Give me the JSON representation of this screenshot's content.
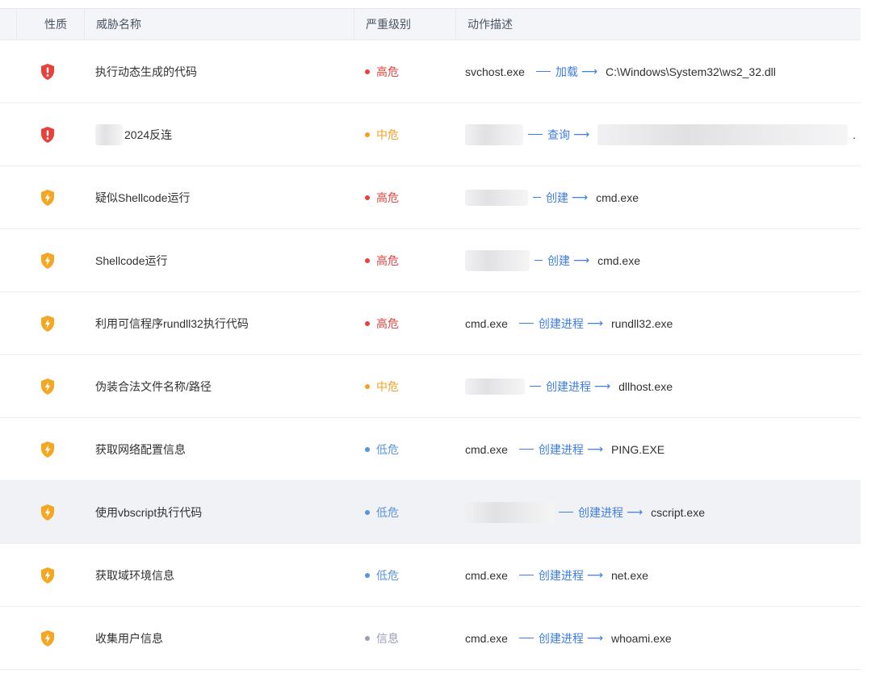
{
  "header": {
    "nature": "性质",
    "name": "威胁名称",
    "level": "严重级别",
    "action": "动作描述"
  },
  "colors": {
    "high": "#e8403a",
    "medium": "#f3a024",
    "low": "#5a93e0",
    "info": "#9a9eb5",
    "shield_red": "#e8403a",
    "shield_orange": "#f5a623",
    "link": "#3d7ee9"
  },
  "rows": [
    {
      "icon": "shield-alert-icon",
      "name": "执行动态生成的代码",
      "level": "高危",
      "level_key": "high",
      "src": "svchost.exe",
      "verb": "加载",
      "dst": "C:\\Windows\\System32\\ws2_32.dll"
    },
    {
      "icon": "shield-alert-icon",
      "name": "2024反连",
      "level": "中危",
      "level_key": "medium",
      "src": "",
      "verb": "查询",
      "dst": "."
    },
    {
      "icon": "shield-bolt-icon",
      "name": "疑似Shellcode运行",
      "level": "高危",
      "level_key": "high",
      "src": "",
      "verb": "创建",
      "dst": "cmd.exe"
    },
    {
      "icon": "shield-bolt-icon",
      "name": "Shellcode运行",
      "level": "高危",
      "level_key": "high",
      "src": "",
      "verb": "创建",
      "dst": "cmd.exe"
    },
    {
      "icon": "shield-bolt-icon",
      "name": "利用可信程序rundll32执行代码",
      "level": "高危",
      "level_key": "high",
      "src": "cmd.exe",
      "verb": "创建进程",
      "dst": "rundll32.exe"
    },
    {
      "icon": "shield-bolt-icon",
      "name": "伪装合法文件名称/路径",
      "level": "中危",
      "level_key": "medium",
      "src": "",
      "verb": "创建进程",
      "dst": "dllhost.exe"
    },
    {
      "icon": "shield-bolt-icon",
      "name": "获取网络配置信息",
      "level": "低危",
      "level_key": "low",
      "src": "cmd.exe",
      "verb": "创建进程",
      "dst": "PING.EXE"
    },
    {
      "icon": "shield-bolt-icon",
      "name": "使用vbscript执行代码",
      "level": "低危",
      "level_key": "low",
      "src": "",
      "verb": "创建进程",
      "dst": "cscript.exe"
    },
    {
      "icon": "shield-bolt-icon",
      "name": "获取域环境信息",
      "level": "低危",
      "level_key": "low",
      "src": "cmd.exe",
      "verb": "创建进程",
      "dst": "net.exe"
    },
    {
      "icon": "shield-bolt-icon",
      "name": "收集用户信息",
      "level": "信息",
      "level_key": "info",
      "src": "cmd.exe",
      "verb": "创建进程",
      "dst": "whoami.exe"
    }
  ]
}
